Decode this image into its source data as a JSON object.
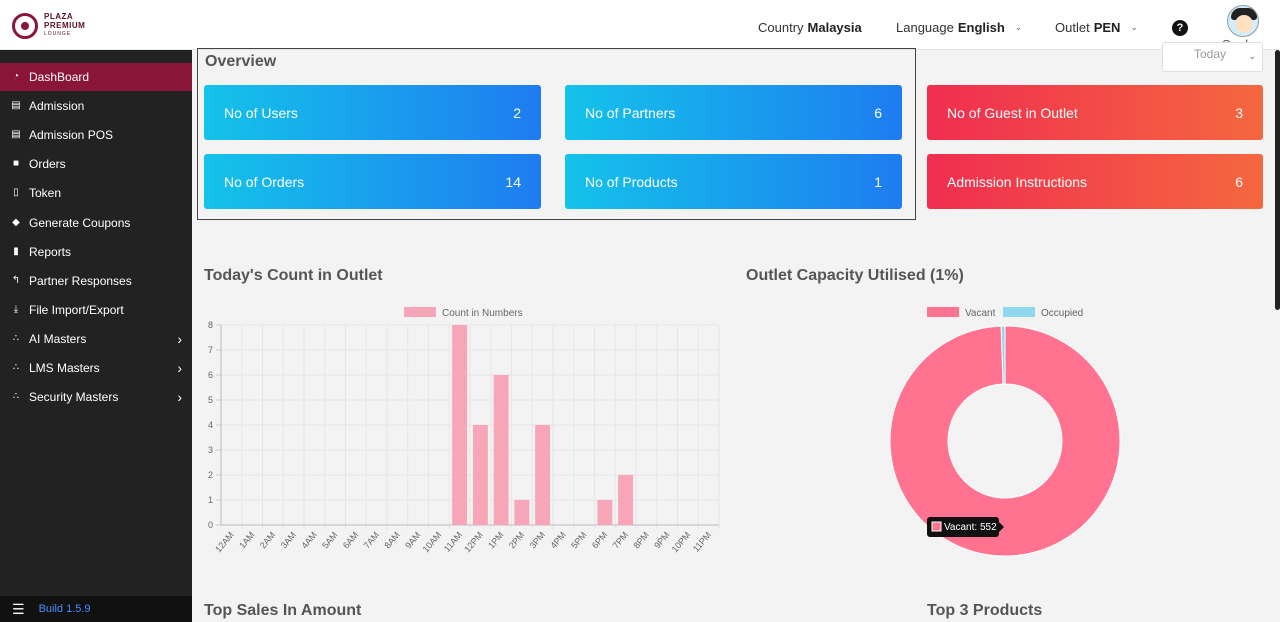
{
  "header": {
    "logo": {
      "line1": "PLAZA",
      "line2": "PREMIUM",
      "line3": "LOUNGE"
    },
    "country": {
      "label": "Country",
      "value": "Malaysia"
    },
    "language": {
      "label": "Language",
      "value": "English"
    },
    "outlet": {
      "label": "Outlet",
      "value": "PEN"
    },
    "help_glyph": "?",
    "user": {
      "name": "Sneha"
    }
  },
  "sidebar": {
    "items": [
      {
        "label": "DashBoard",
        "icon": "dashboard-icon",
        "active": true
      },
      {
        "label": "Admission",
        "icon": "id-card-icon"
      },
      {
        "label": "Admission POS",
        "icon": "id-card-icon"
      },
      {
        "label": "Orders",
        "icon": "cart-icon"
      },
      {
        "label": "Token",
        "icon": "file-icon"
      },
      {
        "label": "Generate Coupons",
        "icon": "tag-icon"
      },
      {
        "label": "Reports",
        "icon": "book-icon"
      },
      {
        "label": "Partner Responses",
        "icon": "reply-icon"
      },
      {
        "label": "File Import/Export",
        "icon": "download-icon"
      },
      {
        "label": "AI Masters",
        "icon": "sitemap-icon",
        "expandable": true
      },
      {
        "label": "LMS Masters",
        "icon": "sitemap-icon",
        "expandable": true
      },
      {
        "label": "Security Masters",
        "icon": "sitemap-icon",
        "expandable": true
      }
    ],
    "footer": {
      "build": "Build 1.5.9"
    }
  },
  "overview": {
    "title": "Overview",
    "filter": "Today",
    "cards": [
      {
        "label": "No of Users",
        "value": "2",
        "color": "blue"
      },
      {
        "label": "No of Partners",
        "value": "6",
        "color": "blue"
      },
      {
        "label": "No of Guest in Outlet",
        "value": "3",
        "color": "red"
      },
      {
        "label": "No of Orders",
        "value": "14",
        "color": "blue"
      },
      {
        "label": "No of Products",
        "value": "1",
        "color": "blue"
      },
      {
        "label": "Admission Instructions",
        "value": "6",
        "color": "red"
      }
    ]
  },
  "sections": {
    "count_title": "Today's Count in Outlet",
    "capacity_title": "Outlet Capacity Utilised (1%)",
    "sales_title": "Top Sales In Amount",
    "products_title": "Top 3 Products"
  },
  "chart_data": [
    {
      "type": "bar",
      "title": "Today's Count in Outlet",
      "series": [
        {
          "name": "Count in Numbers",
          "values": [
            0,
            0,
            0,
            0,
            0,
            0,
            0,
            0,
            0,
            0,
            0,
            8,
            4,
            6,
            1,
            4,
            0,
            0,
            1,
            2,
            0,
            0,
            0,
            0
          ],
          "color": "#f7a6b9"
        }
      ],
      "categories": [
        "12AM",
        "1AM",
        "2AM",
        "3AM",
        "4AM",
        "5AM",
        "6AM",
        "7AM",
        "8AM",
        "9AM",
        "10AM",
        "11AM",
        "12PM",
        "1PM",
        "2PM",
        "3PM",
        "4PM",
        "5PM",
        "6PM",
        "7PM",
        "8PM",
        "9PM",
        "10PM",
        "11PM"
      ],
      "ylim": [
        0,
        8
      ],
      "yticks": [
        0,
        1,
        2,
        3,
        4,
        5,
        6,
        7,
        8
      ],
      "grid": true,
      "legend": "top"
    },
    {
      "type": "pie",
      "title": "Outlet Capacity Utilised (1%)",
      "labels": [
        "Vacant",
        "Occupied"
      ],
      "values": [
        552,
        3
      ],
      "colors": [
        "#ff7390",
        "#8fd8f0"
      ],
      "tooltip": "Vacant: 552",
      "legend": "top"
    }
  ]
}
